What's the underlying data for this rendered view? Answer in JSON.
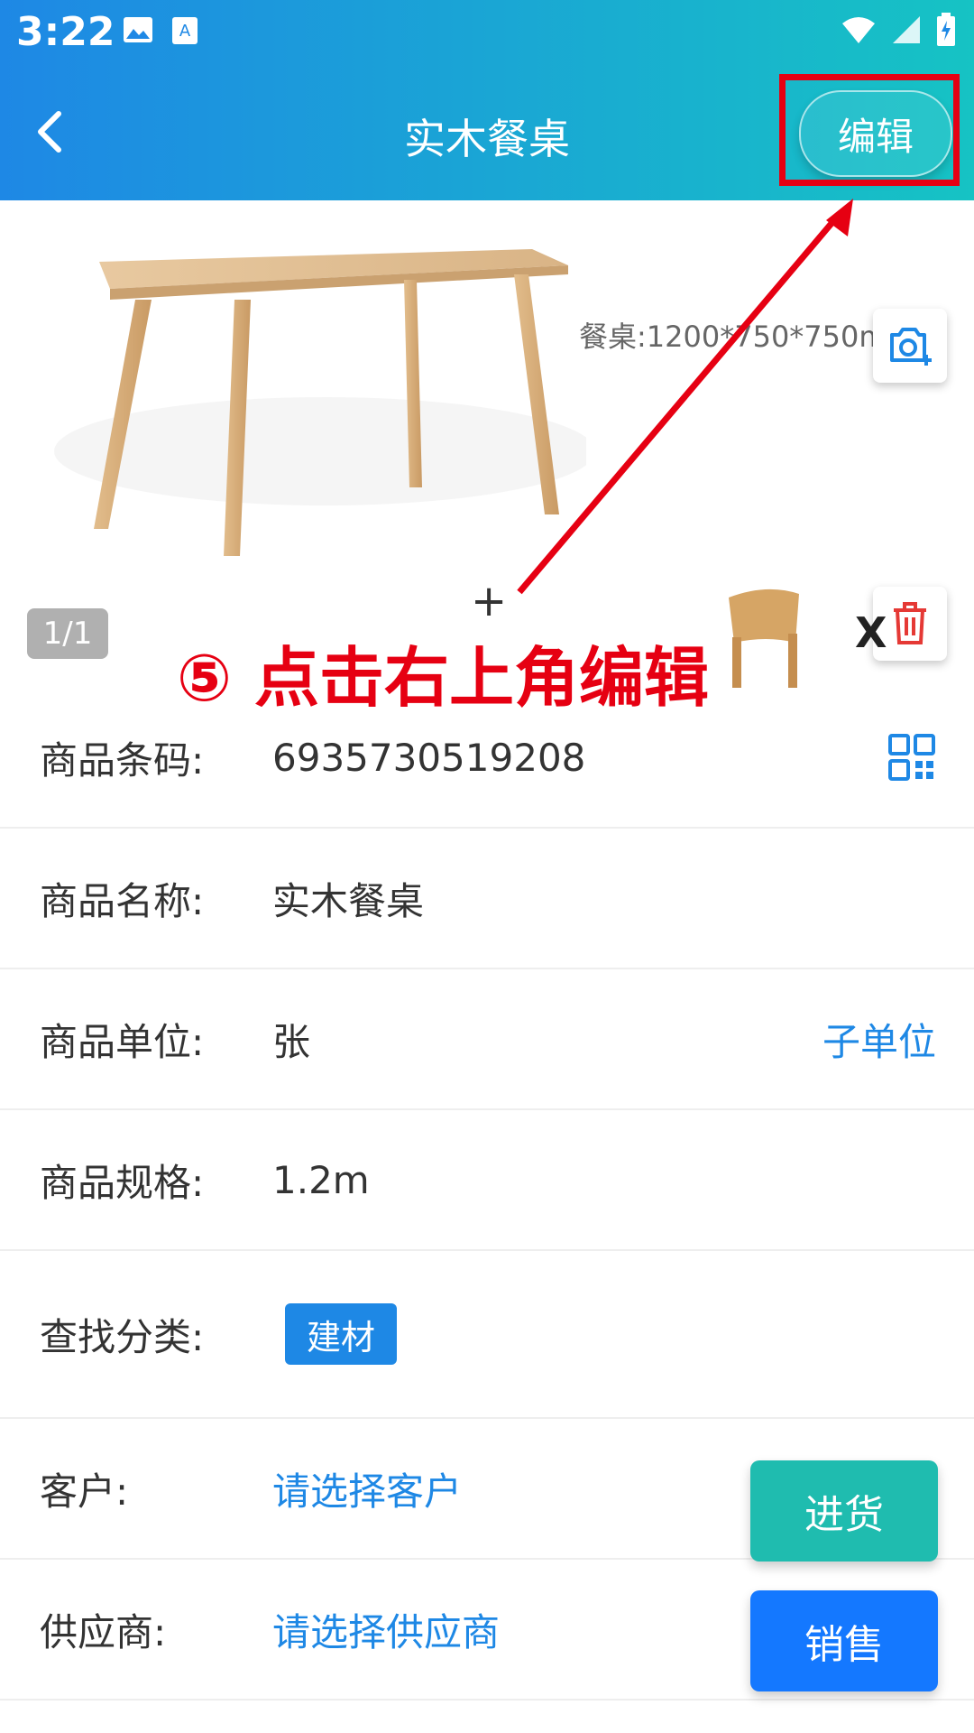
{
  "status_bar": {
    "time": "3:22"
  },
  "app_bar": {
    "title": "实木餐桌",
    "edit_label": "编辑"
  },
  "image_viewer": {
    "counter": "1/1",
    "dimension_text": "餐桌:1200*750*750mm",
    "plus_sign": "+",
    "x_mark": "X"
  },
  "annotation": {
    "text": "⑤ 点击右上角编辑",
    "color": "#e60012"
  },
  "fields": {
    "barcode": {
      "label": "商品条码:",
      "value": "6935730519208"
    },
    "name": {
      "label": "商品名称:",
      "value": "实木餐桌"
    },
    "unit": {
      "label": "商品单位:",
      "value": "张",
      "action": "子单位"
    },
    "spec": {
      "label": "商品规格:",
      "value": "1.2m"
    },
    "category": {
      "label": "查找分类:",
      "tag": "建材"
    },
    "customer": {
      "label": "客户:",
      "placeholder": "请选择客户"
    },
    "supplier": {
      "label": "供应商:",
      "placeholder": "请选择供应商"
    }
  },
  "actions": {
    "purchase": "进货",
    "sales": "销售"
  },
  "colors": {
    "header_start": "#1e88e5",
    "header_end": "#16c3c4",
    "link": "#1e88e5",
    "purchase": "#1fbcaf",
    "sales": "#1478ff"
  },
  "icons": [
    "back-arrow-icon",
    "camera-add-icon",
    "trash-icon",
    "qr-code-icon",
    "wifi-icon",
    "signal-icon",
    "battery-icon",
    "image-icon",
    "app-notification-icon"
  ]
}
